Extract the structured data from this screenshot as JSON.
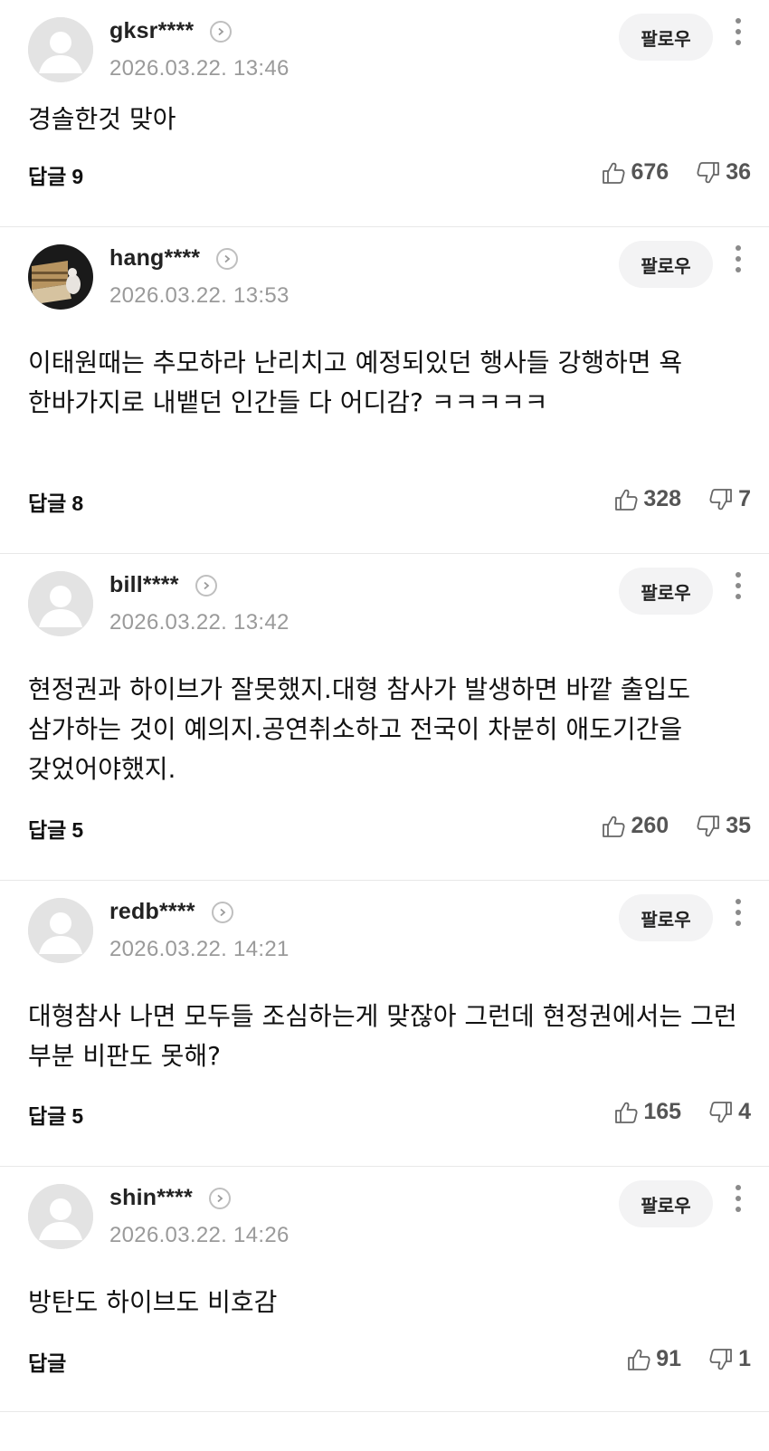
{
  "follow_label": "팔로우",
  "reply_label": "답글",
  "comments": [
    {
      "user": "gksr****",
      "date": "2026.03.22. 13:46",
      "text": "경솔한것 맞아",
      "replies": "9",
      "likes": "676",
      "dislikes": "36",
      "avatar": "default"
    },
    {
      "user": "hang****",
      "date": "2026.03.22. 13:53",
      "text": "이태원때는 추모하라 난리치고 예정되있던 행사들 강행하면 욕 한바가지로 내뱉던 인간들 다 어디감? ㅋㅋㅋㅋㅋ",
      "replies": "8",
      "likes": "328",
      "dislikes": "7",
      "avatar": "photo"
    },
    {
      "user": "bill****",
      "date": "2026.03.22. 13:42",
      "text": "현정권과 하이브가 잘못했지.대형 참사가 발생하면 바깥 출입도 삼가하는 것이 예의지.공연취소하고 전국이 차분히 애도기간을 갖었어야했지.",
      "replies": "5",
      "likes": "260",
      "dislikes": "35",
      "avatar": "default"
    },
    {
      "user": "redb****",
      "date": "2026.03.22. 14:21",
      "text": "대형참사 나면 모두들 조심하는게 맞잖아 그런데 현정권에서는 그런 부분 비판도 못해?",
      "replies": "5",
      "likes": "165",
      "dislikes": "4",
      "avatar": "default"
    },
    {
      "user": "shin****",
      "date": "2026.03.22. 14:26",
      "text": "방탄도 하이브도 비호감",
      "replies": "",
      "likes": "91",
      "dislikes": "1",
      "avatar": "default"
    }
  ]
}
